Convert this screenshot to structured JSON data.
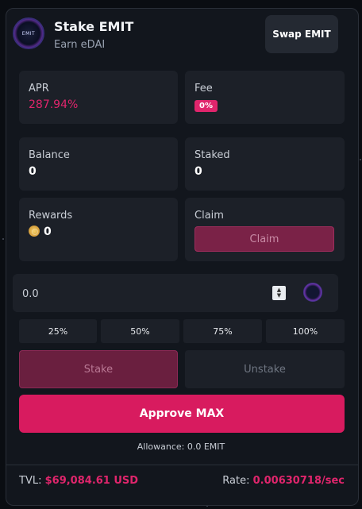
{
  "header": {
    "logo_text": "EMIT",
    "title": "Stake EMIT",
    "subtitle": "Earn eDAI",
    "swap_label": "Swap EMIT"
  },
  "stats": {
    "apr_label": "APR",
    "apr_value": "287.94%",
    "fee_label": "Fee",
    "fee_value": "0%",
    "balance_label": "Balance",
    "balance_value": "0",
    "staked_label": "Staked",
    "staked_value": "0",
    "rewards_label": "Rewards",
    "rewards_value": "0",
    "claim_label": "Claim",
    "claim_button": "Claim"
  },
  "amount": {
    "placeholder": "0.0",
    "token_icon": "emit-token-icon"
  },
  "percent_buttons": [
    "25%",
    "50%",
    "75%",
    "100%"
  ],
  "tabs": {
    "stake": "Stake",
    "unstake": "Unstake"
  },
  "approve_label": "Approve MAX",
  "allowance_text": "Allowance: 0.0 EMIT",
  "footer": {
    "tvl_label": "TVL:",
    "tvl_value": "$69,084.61 USD",
    "rate_label": "Rate:",
    "rate_value": "0.00630718/sec"
  },
  "colors": {
    "accent": "#d81b5f",
    "panel": "#1c2028",
    "background": "#12161d"
  }
}
